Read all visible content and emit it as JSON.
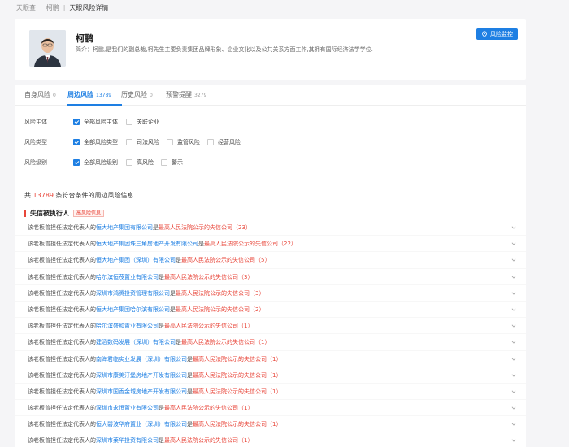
{
  "breadcrumb": [
    "天眼查",
    "柯鹏",
    "天眼风险详情"
  ],
  "profile": {
    "name": "柯鹏",
    "bio": "简介：柯鹏,是我们的副总裁,柯先生主要负责集团品牌形象、企业文化以及公共关系方面工作,其拥有国际经济法学学位.",
    "monitor_label": "风险监控"
  },
  "tabs": [
    {
      "label": "自身风险",
      "count": "0"
    },
    {
      "label": "周边风险",
      "count": "13789"
    },
    {
      "label": "历史风险",
      "count": "0"
    },
    {
      "label": "预警提醒",
      "count": "3279"
    }
  ],
  "filters": [
    {
      "label": "风险主体",
      "options": [
        {
          "text": "全部风险主体",
          "checked": true
        },
        {
          "text": "关联企业",
          "checked": false
        }
      ]
    },
    {
      "label": "风险类型",
      "options": [
        {
          "text": "全部风险类型",
          "checked": true
        },
        {
          "text": "司法风险",
          "checked": false
        },
        {
          "text": "监管风险",
          "checked": false
        },
        {
          "text": "经营风险",
          "checked": false
        }
      ]
    },
    {
      "label": "风险级别",
      "options": [
        {
          "text": "全部风险级别",
          "checked": true
        },
        {
          "text": "高风险",
          "checked": false
        },
        {
          "text": "警示",
          "checked": false
        }
      ]
    }
  ],
  "summary": {
    "prefix": "共",
    "count": "13789",
    "suffix": "条符合条件的周边风险信息"
  },
  "section": {
    "title": "失信被执行人",
    "badge": "高风险信息"
  },
  "rows": [
    {
      "pre": "该老板曾担任法定代表人的",
      "company": "恒大地产集团有限公司",
      "mid": "是",
      "risk": "最高人民法院公示的失信公司",
      "count": "（23）"
    },
    {
      "pre": "该老板曾担任法定代表人的",
      "company": "恒大地产集团珠三角房地产开发有限公司",
      "mid": "是",
      "risk": "最高人民法院公示的失信公司",
      "count": "（22）"
    },
    {
      "pre": "该老板曾担任法定代表人的",
      "company": "恒大地产集团（深圳）有限公司",
      "mid": "是",
      "risk": "最高人民法院公示的失信公司",
      "count": "（5）"
    },
    {
      "pre": "该老板曾担任法定代表人的",
      "company": "哈尔滨恒茂置业有限公司",
      "mid": "是",
      "risk": "最高人民法院公示的失信公司",
      "count": "（3）"
    },
    {
      "pre": "该老板曾担任法定代表人的",
      "company": "深圳市鸿腾投资管理有限公司",
      "mid": "是",
      "risk": "最高人民法院公示的失信公司",
      "count": "（3）"
    },
    {
      "pre": "该老板曾担任法定代表人的",
      "company": "恒大地产集团哈尔滨有限公司",
      "mid": "是",
      "risk": "最高人民法院公示的失信公司",
      "count": "（2）"
    },
    {
      "pre": "该老板曾担任法定代表人的",
      "company": "哈尔滨盛和置业有限公司",
      "mid": "是",
      "risk": "最高人民法院公示的失信公司",
      "count": "（1）"
    },
    {
      "pre": "该老板曾担任法定代表人的",
      "company": "建滔数码发展（深圳）有限公司",
      "mid": "是",
      "risk": "最高人民法院公示的失信公司",
      "count": "（1）"
    },
    {
      "pre": "该老板曾担任法定代表人的",
      "company": "南海君临实业发展（深圳）有限公司",
      "mid": "是",
      "risk": "最高人民法院公示的失信公司",
      "count": "（1）"
    },
    {
      "pre": "该老板曾担任法定代表人的",
      "company": "深圳市康美汀堡房地产开发有限公司",
      "mid": "是",
      "risk": "最高人民法院公示的失信公司",
      "count": "（1）"
    },
    {
      "pre": "该老板曾担任法定代表人的",
      "company": "深圳市国香金城房地产开发有限公司",
      "mid": "是",
      "risk": "最高人民法院公示的失信公司",
      "count": "（1）"
    },
    {
      "pre": "该老板曾担任法定代表人的",
      "company": "深圳市永恒置业有限公司",
      "mid": "是",
      "risk": "最高人民法院公示的失信公司",
      "count": "（1）"
    },
    {
      "pre": "该老板曾担任法定代表人的",
      "company": "恒大碧波华府置业（深圳）有限公司",
      "mid": "是",
      "risk": "最高人民法院公示的失信公司",
      "count": "（1）"
    },
    {
      "pre": "该老板曾担任法定代表人的",
      "company": "深圳市莱华投资有限公司",
      "mid": "是",
      "risk": "最高人民法院公示的失信公司",
      "count": "（1）"
    }
  ],
  "colors": {
    "accent": "#1e7fe3",
    "danger": "#e8463a"
  }
}
